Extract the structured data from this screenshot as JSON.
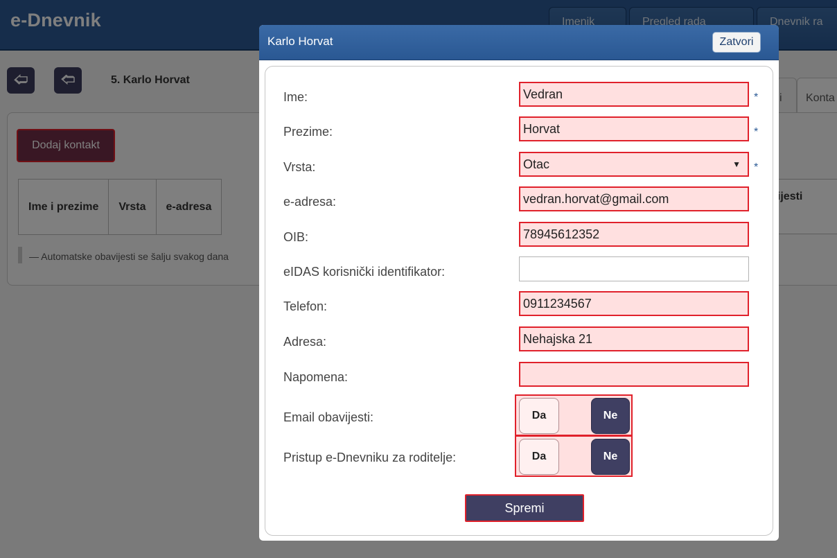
{
  "app": {
    "brand": "e-Dnevnik",
    "nav": [
      "Imenik",
      "Pregled rada",
      "Dnevnik ra"
    ],
    "student_title": "5. Karlo Horvat",
    "prev_icon": "arrow-left-icon",
    "next_icon": "arrow-right-icon",
    "tabs": [
      "i",
      "Konta"
    ],
    "add_contact_label": "Dodaj kontakt",
    "table_headers": [
      "Ime i prezime",
      "Vrsta",
      "e-adresa"
    ],
    "table_header_right": "vijesti",
    "note": "— Automatske obavijesti se šalju svakog dana"
  },
  "modal": {
    "title": "Karlo Horvat",
    "close_label": "Zatvori",
    "fields": {
      "ime": {
        "label": "Ime:",
        "value": "Vedran",
        "required": "*"
      },
      "prezime": {
        "label": "Prezime:",
        "value": "Horvat",
        "required": "*"
      },
      "vrsta": {
        "label": "Vrsta:",
        "value": "Otac",
        "required": "*"
      },
      "email": {
        "label": "e-adresa:",
        "value": "vedran.horvat@gmail.com"
      },
      "oib": {
        "label": "OIB:",
        "value": "78945612352"
      },
      "eidas": {
        "label": "eIDAS korisnički identifikator:",
        "value": ""
      },
      "telefon": {
        "label": "Telefon:",
        "value": "0911234567"
      },
      "adresa": {
        "label": "Adresa:",
        "value": "Nehajska 21"
      },
      "napomena": {
        "label": "Napomena:",
        "value": ""
      }
    },
    "email_notifications": {
      "label": "Email obavijesti:",
      "yes": "Da",
      "no": "Ne",
      "selected": "Ne"
    },
    "parent_access": {
      "label": "Pristup e-Dnevniku za roditelje:",
      "yes": "Da",
      "no": "Ne",
      "selected": "Ne"
    },
    "save_label": "Spremi"
  },
  "colors": {
    "header_blue": "#2c5b96",
    "error_border": "#e0212b",
    "error_fill": "#ffe0e0",
    "button_dark": "#3f3f62"
  }
}
